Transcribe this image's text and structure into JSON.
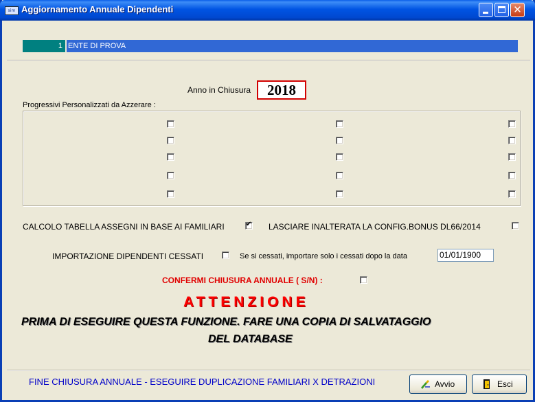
{
  "window": {
    "title": "Aggiornamento Annuale Dipendenti",
    "icon": "app-icon",
    "icon_text": "sim",
    "controls": [
      "minimize-icon",
      "maximize-icon",
      "close-icon"
    ]
  },
  "ente": {
    "code": "1",
    "name": "ENTE DI PROVA"
  },
  "anno": {
    "label": "Anno in Chiusura",
    "value": "2018"
  },
  "progressivi": {
    "label": "Progressivi Personalizzati  da Azzerare  :",
    "checkboxes": [
      [
        false,
        false,
        false
      ],
      [
        false,
        false,
        false
      ],
      [
        false,
        false,
        false
      ],
      [
        false,
        false,
        false
      ],
      [
        false,
        false,
        false
      ]
    ]
  },
  "options": {
    "calcolo_label": "CALCOLO TABELLA ASSEGNI IN BASE AI FAMILIARI",
    "calcolo_checked": true,
    "bonus_label": "LASCIARE INALTERATA LA CONFIG.BONUS DL66/2014",
    "bonus_checked": false,
    "cessati_label": "IMPORTAZIONE DIPENDENTI CESSATI",
    "cessati_checked": false,
    "data_label": "Se si cessati, importare solo i cessati dopo la data",
    "data_value": "01/01/1900",
    "confirm_label": "CONFERMI CHIUSURA ANNUALE ( S/N) :",
    "confirm_checked": false
  },
  "warning": {
    "title": "ATTENZIONE",
    "line1": "PRIMA DI ESEGUIRE QUESTA FUNZIONE. FARE UNA COPIA DI SALVATAGGIO",
    "line2": "DEL DATABASE"
  },
  "footer": {
    "message": "FINE CHIUSURA ANNUALE - ESEGUIRE DUPLICAZIONE FAMILIARI X DETRAZIONI",
    "avvio_label": "Avvio",
    "esci_label": "Esci"
  },
  "colors": {
    "titlebar": "#0054e3",
    "ente_code_bg": "#008080",
    "ente_name_bg": "#3168d5",
    "warning_red": "#ff0000",
    "footer_text": "#0000c8"
  }
}
